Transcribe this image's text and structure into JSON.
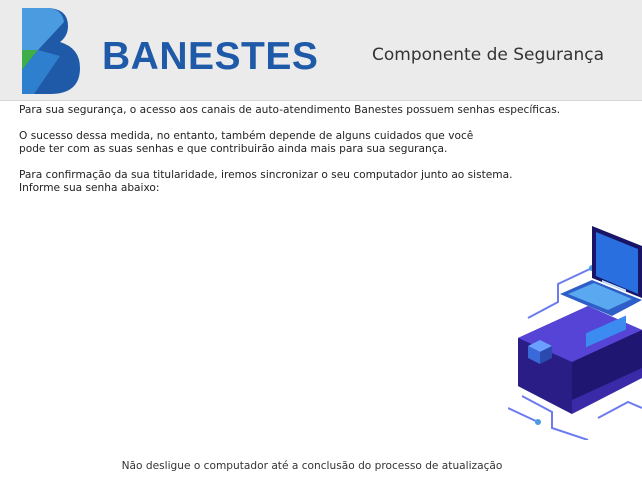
{
  "header": {
    "brand": "BANESTES",
    "component_title": "Componente de Segurança"
  },
  "content": {
    "p1_l1": "Para sua segurança, o acesso aos canais de auto-atendimento Banestes possuem senhas específicas.",
    "p2_l1": "O sucesso dessa medida, no entanto, também depende de alguns cuidados que você",
    "p2_l2": "pode ter com as suas senhas e que contribuirão ainda mais para sua segurança.",
    "p3_l1": "Para confirmação da sua titularidade, iremos sincronizar o seu computador junto ao sistema.",
    "p3_l2": "Informe sua senha abaixo:"
  },
  "footer": {
    "notice": "Não desligue o computador até a conclusão do processo de atualização"
  },
  "colors": {
    "brand_blue": "#1e5aa8",
    "logo_light_blue": "#4a9be0",
    "logo_green": "#3fae49",
    "header_bg": "#ebebeb"
  },
  "icons": [
    "banestes-logo-icon",
    "laptop-network-illustration"
  ]
}
